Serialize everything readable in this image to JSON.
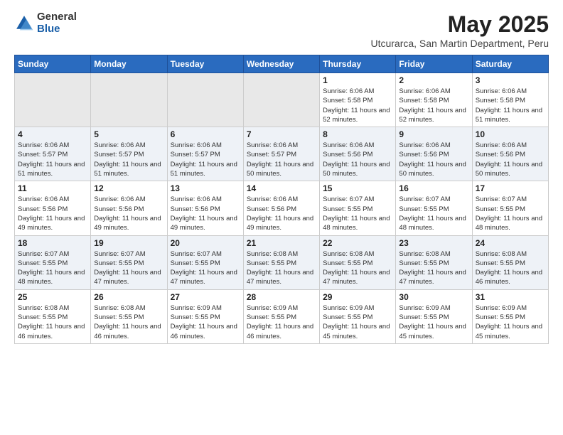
{
  "logo": {
    "general": "General",
    "blue": "Blue"
  },
  "title": "May 2025",
  "location": "Utcurarca, San Martin Department, Peru",
  "weekdays": [
    "Sunday",
    "Monday",
    "Tuesday",
    "Wednesday",
    "Thursday",
    "Friday",
    "Saturday"
  ],
  "weeks": [
    [
      {
        "day": "",
        "empty": true
      },
      {
        "day": "",
        "empty": true
      },
      {
        "day": "",
        "empty": true
      },
      {
        "day": "",
        "empty": true
      },
      {
        "day": "1",
        "sunrise": "6:06 AM",
        "sunset": "5:58 PM",
        "daylight": "11 hours and 52 minutes."
      },
      {
        "day": "2",
        "sunrise": "6:06 AM",
        "sunset": "5:58 PM",
        "daylight": "11 hours and 52 minutes."
      },
      {
        "day": "3",
        "sunrise": "6:06 AM",
        "sunset": "5:58 PM",
        "daylight": "11 hours and 51 minutes."
      }
    ],
    [
      {
        "day": "4",
        "sunrise": "6:06 AM",
        "sunset": "5:57 PM",
        "daylight": "11 hours and 51 minutes."
      },
      {
        "day": "5",
        "sunrise": "6:06 AM",
        "sunset": "5:57 PM",
        "daylight": "11 hours and 51 minutes."
      },
      {
        "day": "6",
        "sunrise": "6:06 AM",
        "sunset": "5:57 PM",
        "daylight": "11 hours and 51 minutes."
      },
      {
        "day": "7",
        "sunrise": "6:06 AM",
        "sunset": "5:57 PM",
        "daylight": "11 hours and 50 minutes."
      },
      {
        "day": "8",
        "sunrise": "6:06 AM",
        "sunset": "5:56 PM",
        "daylight": "11 hours and 50 minutes."
      },
      {
        "day": "9",
        "sunrise": "6:06 AM",
        "sunset": "5:56 PM",
        "daylight": "11 hours and 50 minutes."
      },
      {
        "day": "10",
        "sunrise": "6:06 AM",
        "sunset": "5:56 PM",
        "daylight": "11 hours and 50 minutes."
      }
    ],
    [
      {
        "day": "11",
        "sunrise": "6:06 AM",
        "sunset": "5:56 PM",
        "daylight": "11 hours and 49 minutes."
      },
      {
        "day": "12",
        "sunrise": "6:06 AM",
        "sunset": "5:56 PM",
        "daylight": "11 hours and 49 minutes."
      },
      {
        "day": "13",
        "sunrise": "6:06 AM",
        "sunset": "5:56 PM",
        "daylight": "11 hours and 49 minutes."
      },
      {
        "day": "14",
        "sunrise": "6:06 AM",
        "sunset": "5:56 PM",
        "daylight": "11 hours and 49 minutes."
      },
      {
        "day": "15",
        "sunrise": "6:07 AM",
        "sunset": "5:55 PM",
        "daylight": "11 hours and 48 minutes."
      },
      {
        "day": "16",
        "sunrise": "6:07 AM",
        "sunset": "5:55 PM",
        "daylight": "11 hours and 48 minutes."
      },
      {
        "day": "17",
        "sunrise": "6:07 AM",
        "sunset": "5:55 PM",
        "daylight": "11 hours and 48 minutes."
      }
    ],
    [
      {
        "day": "18",
        "sunrise": "6:07 AM",
        "sunset": "5:55 PM",
        "daylight": "11 hours and 48 minutes."
      },
      {
        "day": "19",
        "sunrise": "6:07 AM",
        "sunset": "5:55 PM",
        "daylight": "11 hours and 47 minutes."
      },
      {
        "day": "20",
        "sunrise": "6:07 AM",
        "sunset": "5:55 PM",
        "daylight": "11 hours and 47 minutes."
      },
      {
        "day": "21",
        "sunrise": "6:08 AM",
        "sunset": "5:55 PM",
        "daylight": "11 hours and 47 minutes."
      },
      {
        "day": "22",
        "sunrise": "6:08 AM",
        "sunset": "5:55 PM",
        "daylight": "11 hours and 47 minutes."
      },
      {
        "day": "23",
        "sunrise": "6:08 AM",
        "sunset": "5:55 PM",
        "daylight": "11 hours and 47 minutes."
      },
      {
        "day": "24",
        "sunrise": "6:08 AM",
        "sunset": "5:55 PM",
        "daylight": "11 hours and 46 minutes."
      }
    ],
    [
      {
        "day": "25",
        "sunrise": "6:08 AM",
        "sunset": "5:55 PM",
        "daylight": "11 hours and 46 minutes."
      },
      {
        "day": "26",
        "sunrise": "6:08 AM",
        "sunset": "5:55 PM",
        "daylight": "11 hours and 46 minutes."
      },
      {
        "day": "27",
        "sunrise": "6:09 AM",
        "sunset": "5:55 PM",
        "daylight": "11 hours and 46 minutes."
      },
      {
        "day": "28",
        "sunrise": "6:09 AM",
        "sunset": "5:55 PM",
        "daylight": "11 hours and 46 minutes."
      },
      {
        "day": "29",
        "sunrise": "6:09 AM",
        "sunset": "5:55 PM",
        "daylight": "11 hours and 45 minutes."
      },
      {
        "day": "30",
        "sunrise": "6:09 AM",
        "sunset": "5:55 PM",
        "daylight": "11 hours and 45 minutes."
      },
      {
        "day": "31",
        "sunrise": "6:09 AM",
        "sunset": "5:55 PM",
        "daylight": "11 hours and 45 minutes."
      }
    ]
  ]
}
